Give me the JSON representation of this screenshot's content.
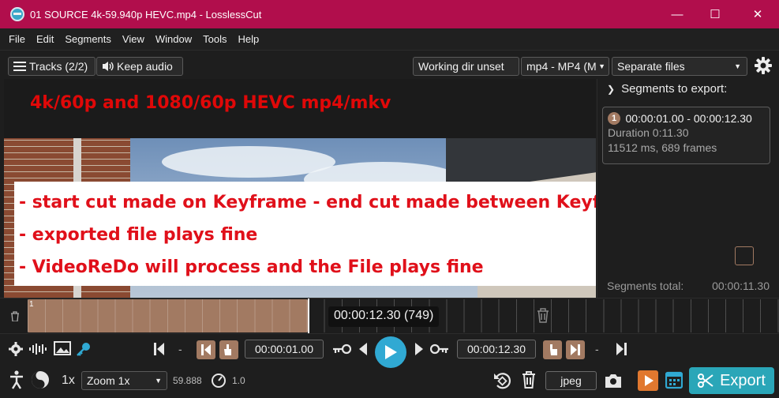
{
  "window": {
    "title": "01 SOURCE 4k-59.940p HEVC.mp4 - LosslessCut",
    "minimize": "—",
    "maximize": "☐",
    "close": "✕"
  },
  "menu": [
    "File",
    "Edit",
    "Segments",
    "View",
    "Window",
    "Tools",
    "Help"
  ],
  "toolbar": {
    "tracks_label": "Tracks (2/2)",
    "keep_audio_label": "Keep audio",
    "working_dir_label": "Working dir unset",
    "format_value": "mp4 - MP4 (M",
    "mode_value": "Separate files"
  },
  "overlay": {
    "top_text": "4k/60p and 1080/60p HEVC mp4/mkv",
    "lines": [
      "- start cut made on Keyframe - end cut made between Keyframe",
      "- exported file plays fine",
      "- VideoReDo will process and the File plays fine"
    ]
  },
  "segments_panel": {
    "header": "Segments to export:",
    "segment": {
      "number": "1",
      "range": "00:00:01.00 - 00:00:12.30",
      "duration": "Duration 0:11.30",
      "details": "11512 ms, 689 frames"
    },
    "total_label": "Segments total:",
    "total_value": "00:00:11.30"
  },
  "timeline": {
    "marker": "1",
    "current_time": "00:00:12.30 (749)"
  },
  "controls": {
    "start_time": "00:00:01.00",
    "end_time": "00:00:12.30",
    "dash": "-",
    "speed": "1x",
    "zoom_value": "Zoom 1x",
    "fps_value": "59.888",
    "playback_rate": "1.0",
    "capture_format": "jpeg",
    "export_label": "Export"
  },
  "colors": {
    "titlebar": "#b10e4c",
    "accent": "#30a9d3",
    "segment": "#a27a62",
    "export_button": "#2aa6b8",
    "overlay_text": "#e0101a"
  }
}
